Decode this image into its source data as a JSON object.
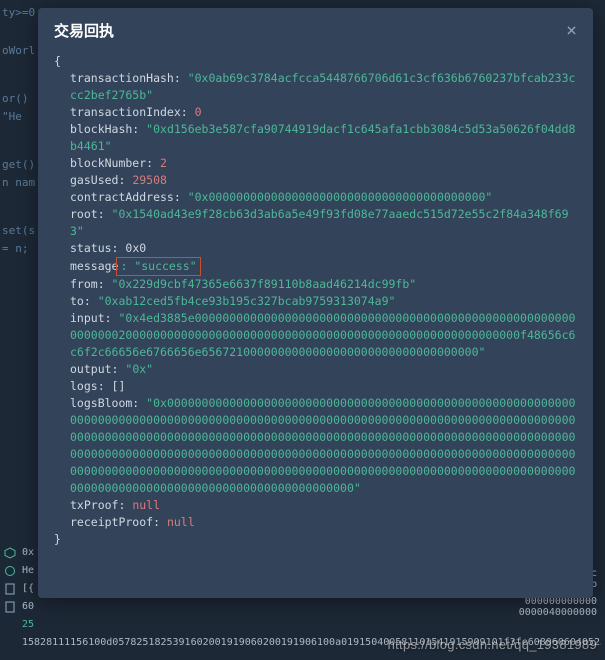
{
  "modal": {
    "title": "交易回执",
    "close_label": "×"
  },
  "receipt": {
    "transactionHash": "\"0x0ab69c3784acfcca5448766706d61c3cf636b6760237bfcab233ccc2bef2765b\"",
    "transactionIndex": "0",
    "blockHash": "\"0xd156eb3e587cfa90744919dacf1c645afa1cbb3084c5d53a50626f04dd8b4461\"",
    "blockNumber": "2",
    "gasUsed": "29508",
    "contractAddress": "\"0x0000000000000000000000000000000000000000\"",
    "root": "\"0x1540ad43e9f28cb63d3ab6a5e49f93fd08e77aaedc515d72e55c2f84a348f693\"",
    "status": "0x0",
    "message_key": "message",
    "message_value": ": \"success\"",
    "from": "\"0x229d9cbf47365e6637f89110b8aad46214dc99fb\"",
    "to": "\"0xab12ced5fb4ce93b195c327bcab9759313074a9\"",
    "input": "\"0x4ed3885e000000000000000000000000000000000000000000000000000000000000002000000000000000000000000000000000000000000000000000000000f48656c6c6f2c66656e6766656e6567210000000000000000000000000000000000\"",
    "output": "\"0x\"",
    "logs": "[]",
    "logsBloom": "\"0x00000000000000000000000000000000000000000000000000000000000000000000000000000000000000000000000000000000000000000000000000000000000000000000000000000000000000000000000000000000000000000000000000000000000000000000000000000000000000000000000000000000000000000000000000000000000000000000000000000000000000000000000000000000000000000000000000000000000000000000000000000000000000000000000000000000\"",
    "txProof": "null",
    "receiptProof": "null"
  },
  "bg": {
    "l1": "ty>=0",
    "l2": "oWorl",
    "l3": "or()",
    "l4": "\"He",
    "l5": "get()",
    "l6": "n nam",
    "l7": "set(s",
    "l8": "= n;"
  },
  "bottom": {
    "r1": "0x",
    "r2": "He",
    "r3": "[{",
    "r4": "60",
    "r4_hex": "25",
    "r4_line": "15828111156100d0578251825391602001919060200191906100a019150400581101541915909101f3fe60806060405234801",
    "right1": "\",\"type\":\"func",
    "right2": "\",\"nonpayab",
    "right3": "000000000000",
    "right4": "0000040000000"
  },
  "watermark": "https://blog.csdn.net/qq_19381989"
}
